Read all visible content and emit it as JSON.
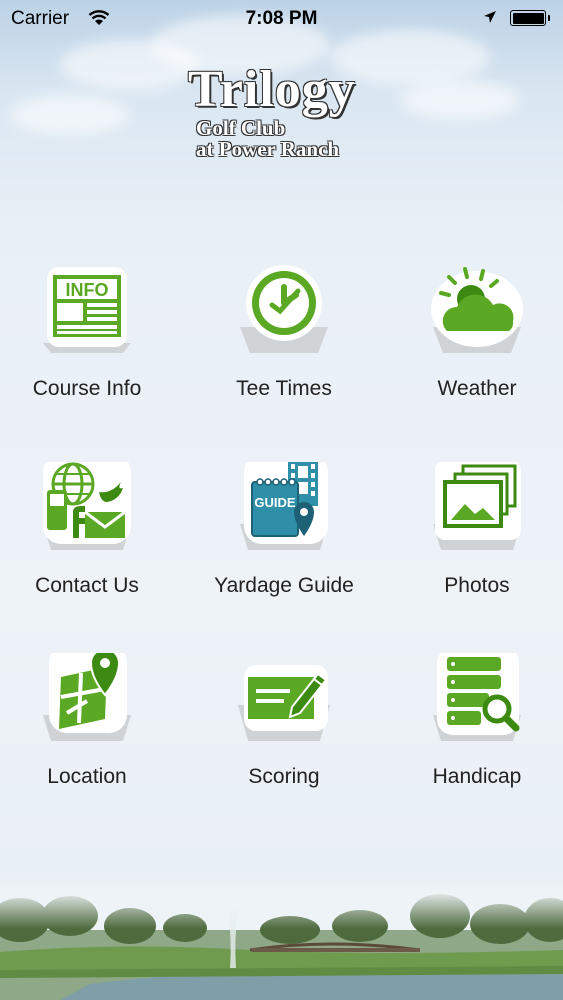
{
  "status_bar": {
    "carrier": "Carrier",
    "time": "7:08 PM",
    "battery_level": 1.0
  },
  "logo": {
    "title": "Trilogy",
    "subtitle_line1": "Golf Club",
    "subtitle_line2": "at Power Ranch"
  },
  "menu": {
    "items": [
      {
        "label": "Course Info",
        "icon": "info-newspaper-icon"
      },
      {
        "label": "Tee Times",
        "icon": "clock-icon"
      },
      {
        "label": "Weather",
        "icon": "sun-cloud-icon"
      },
      {
        "label": "Contact Us",
        "icon": "contact-globe-phone-icon"
      },
      {
        "label": "Yardage Guide",
        "icon": "guide-book-icon"
      },
      {
        "label": "Photos",
        "icon": "photos-icon"
      },
      {
        "label": "Location",
        "icon": "map-pin-icon"
      },
      {
        "label": "Scoring",
        "icon": "scorecard-pencil-icon"
      },
      {
        "label": "Handicap",
        "icon": "database-search-icon"
      }
    ],
    "guide_badge": "GUIDE",
    "info_badge": "INFO"
  },
  "colors": {
    "accent_green": "#5aa823",
    "dark_green": "#3d8a12",
    "text": "#222222"
  }
}
